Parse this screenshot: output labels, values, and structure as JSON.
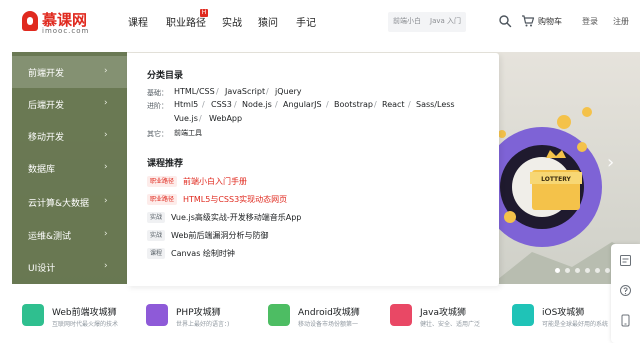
{
  "header": {
    "logo_cn": "慕课网",
    "logo_en": "imooc.com",
    "nav": [
      "课程",
      "职业路径",
      "实战",
      "猿问",
      "手记"
    ],
    "hot_badge": "H",
    "search_tags": [
      "前端小白",
      "Java 入门"
    ],
    "cart_label": "购物车",
    "login": "登录",
    "register": "注册"
  },
  "sidebar": {
    "items": [
      {
        "label": "前端开发",
        "arrow": "›"
      },
      {
        "label": "后端开发",
        "arrow": "›"
      },
      {
        "label": "移动开发",
        "arrow": "›"
      },
      {
        "label": "数据库",
        "arrow": "›"
      },
      {
        "label": "云计算&大数据",
        "arrow": "›"
      },
      {
        "label": "运维&测试",
        "arrow": "›"
      },
      {
        "label": "UI设计",
        "arrow": "›"
      }
    ]
  },
  "dropdown": {
    "category_heading": "分类目录",
    "rows": [
      {
        "label": "基础：",
        "links": [
          "HTML/CSS",
          "JavaScript",
          "jQuery"
        ]
      },
      {
        "label": "进阶：",
        "links": [
          "Html5",
          "CSS3",
          "Node.js",
          "AngularJS",
          "Bootstrap",
          "React",
          "Sass/Less"
        ]
      },
      {
        "label": "",
        "links": [
          "Vue.js",
          "WebApp"
        ]
      },
      {
        "label": "其它：",
        "links": [
          "前端工具"
        ]
      }
    ],
    "separator": "/",
    "recommend_heading": "课程推荐",
    "courses": [
      {
        "tag": "职业路径",
        "title": "前端小白入门手册"
      },
      {
        "tag": "职业路径",
        "title": "HTML5与CSS3实现动态网页"
      },
      {
        "tag": "实战",
        "title": "Vue.js高级实战-开发移动端音乐App"
      },
      {
        "tag": "实战",
        "title": "Web前后端漏洞分析与防御"
      },
      {
        "tag": "课程",
        "title": "Canvas 绘制时钟"
      }
    ]
  },
  "banner": {
    "lottery_text": "LOTTERY",
    "next_arrow": "›",
    "dot_count": 6,
    "active_dot": 0
  },
  "tools": [
    "feedback-icon",
    "help-icon",
    "app-icon"
  ],
  "careers": [
    {
      "title": "Web前端攻城狮",
      "desc": "互联网时代最火爆的技术",
      "color": "#2fbf8f"
    },
    {
      "title": "PHP攻城狮",
      "desc": "世界上最好的语言：)",
      "color": "#8e5ad8"
    },
    {
      "title": "Android攻城狮",
      "desc": "移动设备市场份额第一",
      "color": "#4dbd63"
    },
    {
      "title": "Java攻城狮",
      "desc": "健壮、安全、适用广泛",
      "color": "#e94865"
    },
    {
      "title": "iOS攻城狮",
      "desc": "可能是全球最好用的系统",
      "color": "#1fc3b7"
    }
  ],
  "colors": {
    "brand": "#e02a1f",
    "sidebar": "#5f7048"
  }
}
